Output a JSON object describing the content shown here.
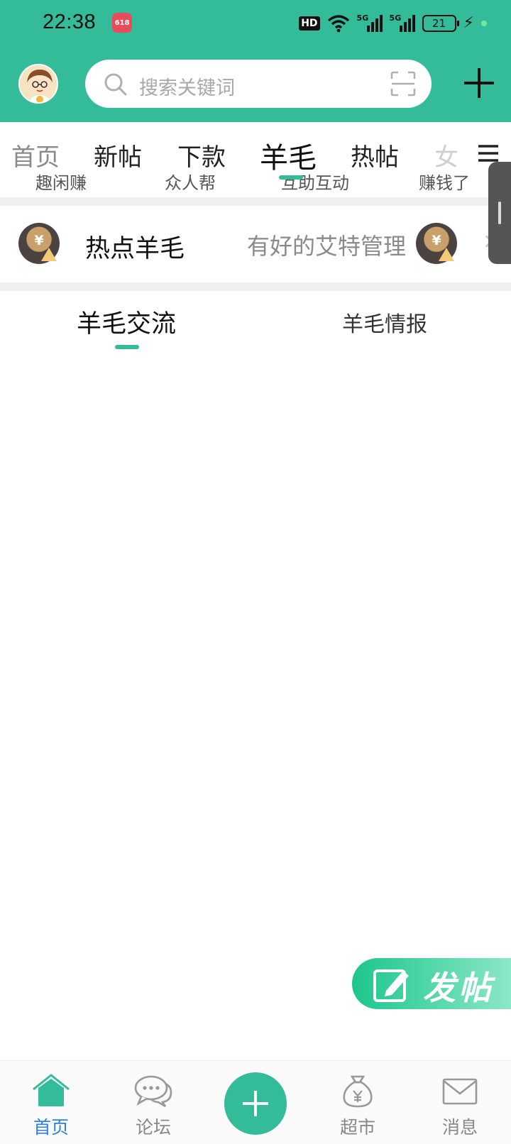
{
  "status_bar": {
    "time": "22:38",
    "app_badge": "618",
    "network_label": "HD",
    "sim1": "5G",
    "sim2": "5G",
    "battery": "21"
  },
  "header": {
    "search_placeholder": "搜索关键词",
    "accent_color": "#33bb9a"
  },
  "category_tabs": {
    "items": [
      {
        "label": "首页"
      },
      {
        "label": "新帖"
      },
      {
        "label": "下款"
      },
      {
        "label": "羊毛"
      },
      {
        "label": "热帖"
      },
      {
        "label": "女"
      }
    ],
    "active_index": 3,
    "sub_labels": [
      "趣闲赚",
      "众人帮",
      "互助互动",
      "赚钱了"
    ]
  },
  "hot_bar": {
    "title": "热点羊毛",
    "item": "有好的艾特管理",
    "coin_symbol": "¥"
  },
  "sub_tabs": {
    "items": [
      {
        "label": "羊毛交流"
      },
      {
        "label": "羊毛情报"
      }
    ],
    "active_index": 0
  },
  "post_button": {
    "label": "发帖"
  },
  "bottom_nav": {
    "items": [
      {
        "label": "首页",
        "icon": "home-icon"
      },
      {
        "label": "论坛",
        "icon": "chat-bubble-icon"
      },
      {
        "label": "",
        "icon": "plus-icon"
      },
      {
        "label": "超市",
        "icon": "money-bag-icon"
      },
      {
        "label": "消息",
        "icon": "mail-icon"
      }
    ],
    "active_index": 0,
    "active_color": "#2d7fe0"
  }
}
